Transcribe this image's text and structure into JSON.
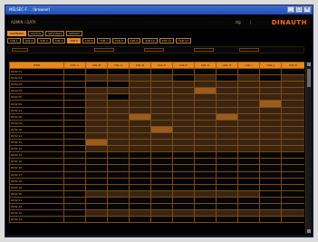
{
  "window": {
    "title": "MELSEC-F ... (browser)"
  },
  "header": {
    "path": "ADMIN  / DATA",
    "user": "ttg",
    "separator": "|",
    "logo": "DINAUTH"
  },
  "tabs_row1": [
    {
      "label": "SUMMARY",
      "active": true
    },
    {
      "label": "STATUS"
    },
    {
      "label": "SETTINGS"
    },
    {
      "label": "REPORT"
    }
  ],
  "tabs_row2": [
    {
      "label": "TAB 1"
    },
    {
      "label": "TAB 2"
    },
    {
      "label": "TAB 3"
    },
    {
      "label": "TAB 4"
    },
    {
      "label": "TAB 5",
      "active": true
    },
    {
      "label": "TAB 6"
    },
    {
      "label": "TAB 7"
    },
    {
      "label": "TAB 8"
    },
    {
      "label": "TAB 9"
    },
    {
      "label": "TAB 10"
    },
    {
      "label": "TAB 11"
    },
    {
      "label": "TAB 12"
    }
  ],
  "table": {
    "headers": [
      "ITEM",
      "COL A",
      "COL B",
      "COL C",
      "COL D",
      "COL E",
      "COL F",
      "COL G",
      "COL H",
      "COL I",
      "COL J",
      "COL K"
    ],
    "rows": [
      {
        "name": "ROW 01",
        "cells": [
          "e",
          "e",
          "e",
          "e",
          "e",
          "e",
          "e",
          "e",
          "e",
          "e",
          "e"
        ]
      },
      {
        "name": "ROW 02",
        "cells": [
          "e",
          "v",
          "v",
          "v",
          "v",
          "e",
          "v",
          "e",
          "v",
          "e",
          "v"
        ]
      },
      {
        "name": "ROW 03",
        "cells": [
          "e",
          "e",
          "e",
          "v",
          "v",
          "v",
          "v",
          "v",
          "v",
          "v",
          "v"
        ]
      },
      {
        "name": "ROW 04",
        "cells": [
          "e",
          "v",
          "v",
          "v",
          "v",
          "v",
          "b",
          "v",
          "v",
          "v",
          "v"
        ]
      },
      {
        "name": "ROW 05",
        "cells": [
          "e",
          "v",
          "e",
          "v",
          "v",
          "v",
          "v",
          "v",
          "v",
          "v",
          "v"
        ]
      },
      {
        "name": "ROW 06",
        "cells": [
          "e",
          "v",
          "v",
          "v",
          "v",
          "v",
          "v",
          "v",
          "v",
          "b",
          "v"
        ]
      },
      {
        "name": "ROW 07",
        "cells": [
          "e",
          "v",
          "v",
          "v",
          "v",
          "v",
          "v",
          "v",
          "v",
          "v",
          "v"
        ]
      },
      {
        "name": "ROW 08",
        "cells": [
          "e",
          "v",
          "v",
          "b",
          "v",
          "v",
          "v",
          "b",
          "v",
          "v",
          "v"
        ]
      },
      {
        "name": "ROW 09",
        "cells": [
          "e",
          "v",
          "v",
          "v",
          "v",
          "v",
          "v",
          "v",
          "v",
          "v",
          "v"
        ]
      },
      {
        "name": "ROW 10",
        "cells": [
          "e",
          "v",
          "v",
          "v",
          "b",
          "v",
          "v",
          "v",
          "v",
          "v",
          "v"
        ]
      },
      {
        "name": "ROW 11",
        "cells": [
          "e",
          "v",
          "v",
          "v",
          "v",
          "v",
          "v",
          "v",
          "v",
          "v",
          "v"
        ]
      },
      {
        "name": "ROW 12",
        "cells": [
          "e",
          "b",
          "v",
          "v",
          "v",
          "v",
          "v",
          "v",
          "v",
          "v",
          "v"
        ]
      },
      {
        "name": "ROW 13",
        "cells": [
          "e",
          "v",
          "v",
          "v",
          "v",
          "v",
          "v",
          "v",
          "v",
          "v",
          "v"
        ]
      },
      {
        "name": "ROW 14",
        "cells": [
          "e",
          "e",
          "e",
          "e",
          "e",
          "e",
          "e",
          "e",
          "e",
          "e",
          "e"
        ]
      },
      {
        "name": "ROW 15",
        "cells": [
          "e",
          "e",
          "e",
          "e",
          "e",
          "e",
          "e",
          "e",
          "e",
          "e",
          "e"
        ]
      },
      {
        "name": "ROW 16",
        "cells": [
          "e",
          "e",
          "e",
          "e",
          "e",
          "e",
          "e",
          "e",
          "e",
          "e",
          "e"
        ]
      },
      {
        "name": "ROW 17",
        "cells": [
          "e",
          "e",
          "e",
          "e",
          "e",
          "e",
          "e",
          "e",
          "e",
          "e",
          "e"
        ]
      },
      {
        "name": "ROW 18",
        "cells": [
          "e",
          "e",
          "e",
          "e",
          "e",
          "e",
          "e",
          "e",
          "e",
          "e",
          "e"
        ]
      },
      {
        "name": "ROW 19",
        "cells": [
          "e",
          "e",
          "e",
          "e",
          "e",
          "e",
          "e",
          "e",
          "e",
          "e",
          "e"
        ]
      },
      {
        "name": "ROW 20",
        "cells": [
          "e",
          "v",
          "v",
          "v",
          "v",
          "v",
          "v",
          "v",
          "v",
          "e",
          "e"
        ]
      },
      {
        "name": "ROW 21",
        "cells": [
          "e",
          "e",
          "e",
          "e",
          "e",
          "e",
          "e",
          "e",
          "e",
          "e",
          "e"
        ]
      },
      {
        "name": "ROW 22",
        "cells": [
          "e",
          "e",
          "e",
          "e",
          "e",
          "e",
          "e",
          "e",
          "e",
          "e",
          "e"
        ]
      },
      {
        "name": "ROW 23",
        "cells": [
          "e",
          "v",
          "v",
          "v",
          "v",
          "v",
          "v",
          "v",
          "v",
          "v",
          "v"
        ]
      },
      {
        "name": "ROW 24",
        "cells": [
          "e",
          "e",
          "e",
          "e",
          "e",
          "e",
          "e",
          "e",
          "e",
          "e",
          "e"
        ]
      }
    ]
  },
  "colors": {
    "accent": "#e8871a",
    "background": "#000000",
    "grid": "#7a4a18",
    "logo": "#ff6a1a"
  },
  "icons": {
    "minimize": "minimize-icon",
    "maximize": "maximize-icon",
    "close": "close-icon"
  }
}
